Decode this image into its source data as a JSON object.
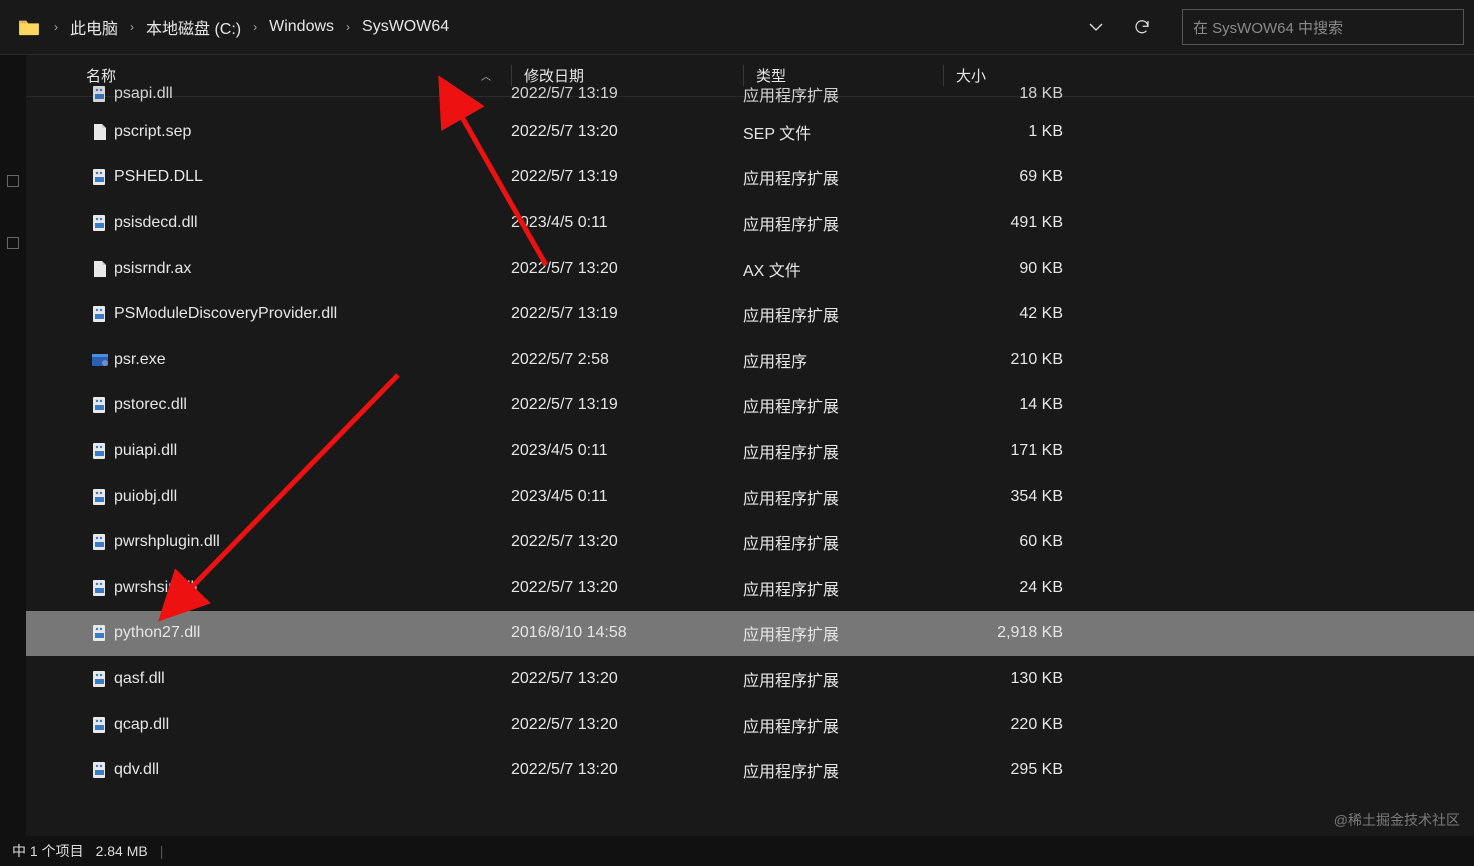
{
  "breadcrumb": {
    "items": [
      "此电脑",
      "本地磁盘 (C:)",
      "Windows",
      "SysWOW64"
    ]
  },
  "search": {
    "placeholder": "在 SysWOW64 中搜索"
  },
  "columns": {
    "name": "名称",
    "date": "修改日期",
    "type": "类型",
    "size": "大小"
  },
  "files": [
    {
      "name": "psapi.dll",
      "date": "2022/5/7 13:19",
      "type": "应用程序扩展",
      "size": "18 KB",
      "icon": "dll",
      "cut": true
    },
    {
      "name": "pscript.sep",
      "date": "2022/5/7 13:20",
      "type": "SEP 文件",
      "size": "1 KB",
      "icon": "file"
    },
    {
      "name": "PSHED.DLL",
      "date": "2022/5/7 13:19",
      "type": "应用程序扩展",
      "size": "69 KB",
      "icon": "dll"
    },
    {
      "name": "psisdecd.dll",
      "date": "2023/4/5 0:11",
      "type": "应用程序扩展",
      "size": "491 KB",
      "icon": "dll"
    },
    {
      "name": "psisrndr.ax",
      "date": "2022/5/7 13:20",
      "type": "AX 文件",
      "size": "90 KB",
      "icon": "file"
    },
    {
      "name": "PSModuleDiscoveryProvider.dll",
      "date": "2022/5/7 13:19",
      "type": "应用程序扩展",
      "size": "42 KB",
      "icon": "dll"
    },
    {
      "name": "psr.exe",
      "date": "2022/5/7 2:58",
      "type": "应用程序",
      "size": "210 KB",
      "icon": "exe"
    },
    {
      "name": "pstorec.dll",
      "date": "2022/5/7 13:19",
      "type": "应用程序扩展",
      "size": "14 KB",
      "icon": "dll"
    },
    {
      "name": "puiapi.dll",
      "date": "2023/4/5 0:11",
      "type": "应用程序扩展",
      "size": "171 KB",
      "icon": "dll"
    },
    {
      "name": "puiobj.dll",
      "date": "2023/4/5 0:11",
      "type": "应用程序扩展",
      "size": "354 KB",
      "icon": "dll"
    },
    {
      "name": "pwrshplugin.dll",
      "date": "2022/5/7 13:20",
      "type": "应用程序扩展",
      "size": "60 KB",
      "icon": "dll"
    },
    {
      "name": "pwrshsip.dll",
      "date": "2022/5/7 13:20",
      "type": "应用程序扩展",
      "size": "24 KB",
      "icon": "dll"
    },
    {
      "name": "python27.dll",
      "date": "2016/8/10 14:58",
      "type": "应用程序扩展",
      "size": "2,918 KB",
      "icon": "dll",
      "selected": true
    },
    {
      "name": "qasf.dll",
      "date": "2022/5/7 13:20",
      "type": "应用程序扩展",
      "size": "130 KB",
      "icon": "dll"
    },
    {
      "name": "qcap.dll",
      "date": "2022/5/7 13:20",
      "type": "应用程序扩展",
      "size": "220 KB",
      "icon": "dll"
    },
    {
      "name": "qdv.dll",
      "date": "2022/5/7 13:20",
      "type": "应用程序扩展",
      "size": "295 KB",
      "icon": "dll"
    }
  ],
  "statusbar": {
    "selection": "中 1 个项目",
    "size": "2.84 MB"
  },
  "watermark": "@稀土掘金技术社区"
}
